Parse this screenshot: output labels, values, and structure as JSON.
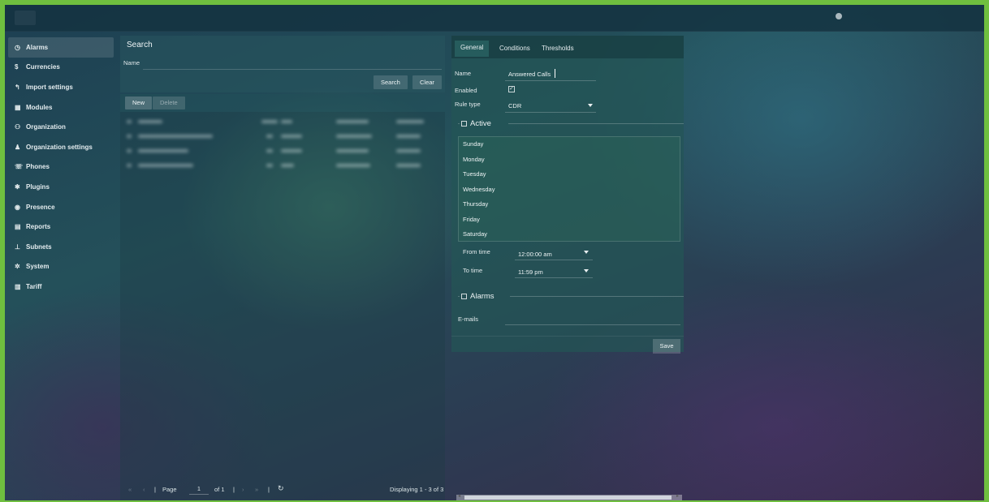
{
  "sidebar": {
    "items": [
      {
        "label": "Alarms",
        "icon": "clock-icon",
        "glyph": "◷",
        "active": true
      },
      {
        "label": "Currencies",
        "icon": "dollar-icon",
        "glyph": "$"
      },
      {
        "label": "Import settings",
        "icon": "import-icon",
        "glyph": "↰"
      },
      {
        "label": "Modules",
        "icon": "grid-icon",
        "glyph": "▦"
      },
      {
        "label": "Organization",
        "icon": "users-icon",
        "glyph": "⚇"
      },
      {
        "label": "Organization settings",
        "icon": "org-settings-icon",
        "glyph": "♟"
      },
      {
        "label": "Phones",
        "icon": "phone-icon",
        "glyph": "☏"
      },
      {
        "label": "Plugins",
        "icon": "puzzle-icon",
        "glyph": "✱"
      },
      {
        "label": "Presence",
        "icon": "presence-icon",
        "glyph": "◉"
      },
      {
        "label": "Reports",
        "icon": "report-icon",
        "glyph": "▤"
      },
      {
        "label": "Subnets",
        "icon": "network-icon",
        "glyph": "⊥"
      },
      {
        "label": "System",
        "icon": "gear-icon",
        "glyph": "✲"
      },
      {
        "label": "Tariff",
        "icon": "tariff-icon",
        "glyph": "▥"
      }
    ]
  },
  "search": {
    "title": "Search",
    "name_label": "Name",
    "search_button": "Search",
    "clear_button": "Clear"
  },
  "grid": {
    "new_button": "New",
    "delete_button": "Delete"
  },
  "pager": {
    "first": "«",
    "prev": "‹",
    "sep1": "|",
    "page_label": "Page",
    "page_value": "1",
    "of_label": "of 1",
    "sep2": "|",
    "next": "›",
    "last": "»",
    "sep3": "|",
    "refresh": "↻",
    "display": "Displaying 1 - 3 of 3"
  },
  "form": {
    "tabs": [
      "General",
      "Conditions",
      "Thresholds"
    ],
    "name_label": "Name",
    "name_value": "Answered Calls",
    "enabled_label": "Enabled",
    "enabled_mark": "✓",
    "rule_type_label": "Rule type",
    "rule_type_value": "CDR",
    "active_legend": "Active",
    "days": [
      "Sunday",
      "Monday",
      "Tuesday",
      "Wednesday",
      "Thursday",
      "Friday",
      "Saturday"
    ],
    "from_time_label": "From time",
    "from_time_value": "12:00:00 am",
    "to_time_label": "To time",
    "to_time_value": "11:59 pm",
    "alarms_legend": "Alarms",
    "emails_label": "E-mails",
    "save_button": "Save"
  },
  "colors": {
    "frame_border": "#6fbf3f",
    "panel": "#2b5a5f"
  }
}
